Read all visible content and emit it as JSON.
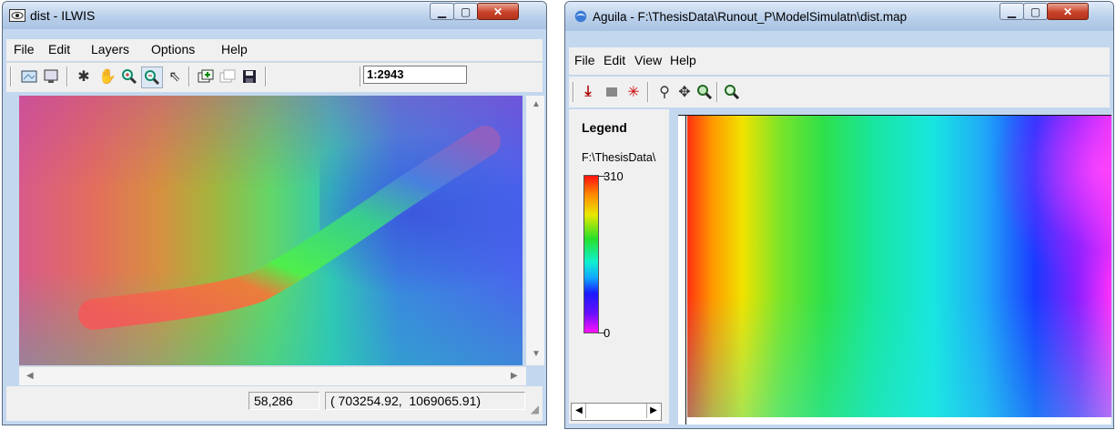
{
  "ilwis": {
    "title": "dist - ILWIS",
    "menu": [
      "File",
      "Edit",
      "Layers",
      "Options",
      "Help"
    ],
    "toolbar_icons": [
      "open-map-icon",
      "display-icon",
      "pointer-star-icon",
      "pan-hand-icon",
      "zoom-in-icon",
      "zoom-out-icon",
      "select-arrow-icon",
      "add-layer-icon",
      "layers-icon",
      "save-icon"
    ],
    "scale": "1:2943",
    "status": {
      "row_col": "58,286",
      "coords": "( 703254.92,  1069065.91)"
    }
  },
  "aguila": {
    "title": "Aguila - F:\\ThesisData\\Runout_P\\ModelSimulatn\\dist.map",
    "menu": [
      "File",
      "Edit",
      "View",
      "Help"
    ],
    "toolbar_icons": [
      "legend-down-icon",
      "square-icon",
      "crosshair-icon",
      "query-icon",
      "move-icon",
      "zoom-in-icon",
      "zoom-out-icon"
    ],
    "legend": {
      "heading": "Legend",
      "file": "F:\\ThesisData\\",
      "max": "310",
      "min": "0"
    }
  },
  "colors": {
    "titlebar": "#b9cfea",
    "window_bg": "#f0f0f0",
    "close_red": "#c9432a"
  }
}
